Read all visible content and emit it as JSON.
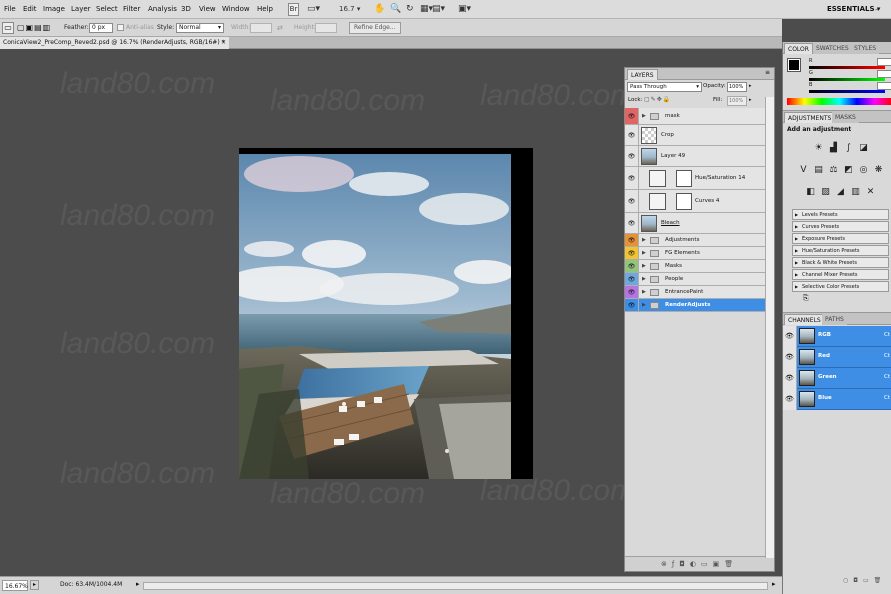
{
  "menu": [
    "File",
    "Edit",
    "Image",
    "Layer",
    "Select",
    "Filter",
    "Analysis",
    "3D",
    "View",
    "Window",
    "Help"
  ],
  "menubar": {
    "zoom": "16.7",
    "workspace": "ESSENTIALS"
  },
  "options": {
    "feather_label": "Feather:",
    "feather_value": "0 px",
    "antialias_label": "Anti-alias",
    "style_label": "Style:",
    "style_value": "Normal",
    "width_label": "Width:",
    "height_label": "Height:",
    "refine_label": "Refine Edge..."
  },
  "document": {
    "tab_title": "ConicaView2_PreComp_Reved2.psd @ 16.7% (RenderAdjusts, RGB/16#) *",
    "close_glyph": "×"
  },
  "watermark": "land80.com",
  "status": {
    "zoom": "16.67%",
    "doc_size": "Doc: 63.4M/1004.4M"
  },
  "layers_panel": {
    "tab": "LAYERS",
    "blend_mode": "Pass Through",
    "opacity_label": "Opacity:",
    "opacity_value": "100%",
    "lock_label": "Lock:",
    "fill_label": "Fill:",
    "fill_value": "100%",
    "layers": [
      {
        "name": "mask",
        "kind": "folder",
        "tag": "#e06666"
      },
      {
        "name": "Crop",
        "kind": "layer-blank",
        "tag": ""
      },
      {
        "name": "Layer 49",
        "kind": "layer-image",
        "tag": ""
      },
      {
        "name": "Hue/Saturation 14",
        "kind": "adjustment",
        "tag": ""
      },
      {
        "name": "Curves 4",
        "kind": "adjustment",
        "tag": ""
      },
      {
        "name": "Bleach",
        "kind": "layer-image",
        "tag": ""
      },
      {
        "name": "Adjustments",
        "kind": "folder",
        "tag": "#e69138"
      },
      {
        "name": "FG Elements",
        "kind": "folder",
        "tag": "#f1c232"
      },
      {
        "name": "Masks",
        "kind": "folder",
        "tag": "#93c47d"
      },
      {
        "name": "People",
        "kind": "folder",
        "tag": "#6fa8dc"
      },
      {
        "name": "EntrancePaint",
        "kind": "folder",
        "tag": "#b674e0"
      },
      {
        "name": "RenderAdjusts",
        "kind": "folder",
        "tag": "",
        "selected": true
      }
    ]
  },
  "color_panel": {
    "tabs": [
      "COLOR",
      "SWATCHES",
      "STYLES"
    ],
    "channels": [
      "R",
      "G",
      "B"
    ]
  },
  "adjustments_panel": {
    "tabs": [
      "ADJUSTMENTS",
      "MASKS"
    ],
    "heading": "Add an adjustment",
    "presets": [
      "Levels Presets",
      "Curves Presets",
      "Exposure Presets",
      "Hue/Saturation Presets",
      "Black & White Presets",
      "Channel Mixer Presets",
      "Selective Color Presets"
    ]
  },
  "channels_panel": {
    "tabs": [
      "CHANNELS",
      "PATHS"
    ],
    "channels": [
      {
        "name": "RGB",
        "shortcut": "Ct"
      },
      {
        "name": "Red",
        "shortcut": "Ct"
      },
      {
        "name": "Green",
        "shortcut": "Ct"
      },
      {
        "name": "Blue",
        "shortcut": "Ct"
      }
    ]
  },
  "colors": {
    "selection": "#3e8ee5",
    "chrome": "#d9d9d9",
    "canvas_bg": "#4c4c4c"
  }
}
